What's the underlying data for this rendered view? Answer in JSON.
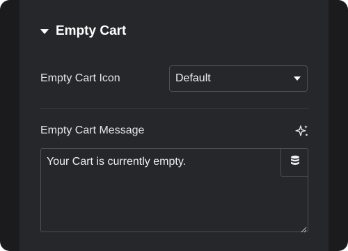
{
  "section": {
    "title": "Empty Cart",
    "caret_icon": "caret-down-icon"
  },
  "empty_cart_icon": {
    "label": "Empty Cart Icon",
    "selected": "Default",
    "arrow_icon": "chevron-down-icon"
  },
  "empty_cart_message": {
    "label": "Empty Cart Message",
    "value": "Your Cart is currently empty.",
    "ai_icon": "sparkle-ai-icon",
    "dynamic_icon": "database-icon",
    "resize_icon": "resize-handle-icon"
  },
  "colors": {
    "background": "#26272b",
    "outer": "#1b1b1d",
    "border": "#4e5054",
    "text": "#e6e6e8"
  }
}
